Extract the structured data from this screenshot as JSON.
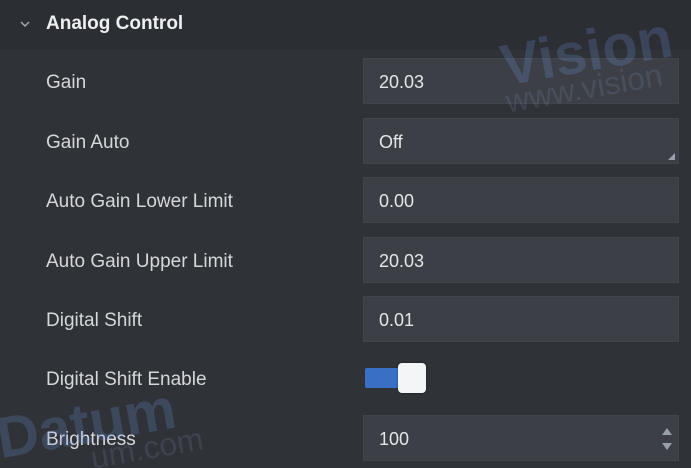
{
  "section": {
    "title": "Analog Control",
    "expanded": true,
    "collapse_icon": "chevron-down-icon"
  },
  "rows": [
    {
      "label": "Gain",
      "control": "text",
      "value": "20.03"
    },
    {
      "label": "Gain Auto",
      "control": "dropdown",
      "value": "Off"
    },
    {
      "label": "Auto Gain Lower Limit",
      "control": "text",
      "value": "0.00"
    },
    {
      "label": "Auto Gain Upper Limit",
      "control": "text",
      "value": "20.03"
    },
    {
      "label": "Digital Shift",
      "control": "text",
      "value": "0.01"
    },
    {
      "label": "Digital Shift Enable",
      "control": "toggle",
      "enabled": true
    },
    {
      "label": "Brightness",
      "control": "spinbox",
      "value": "100"
    }
  ],
  "watermarks": [
    "Vision",
    "www.vision",
    "Datum",
    "um.com"
  ],
  "colors": {
    "panel_bg": "#2f3236",
    "header_bg": "#2b2e32",
    "field_bg": "#3c4046",
    "toggle_on": "#3a6fc6"
  }
}
